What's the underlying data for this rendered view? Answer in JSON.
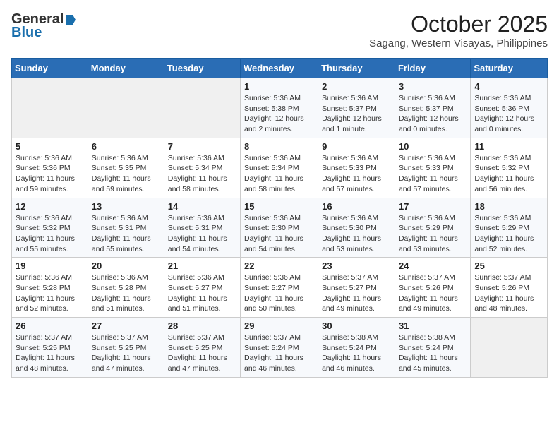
{
  "header": {
    "logo_general": "General",
    "logo_blue": "Blue",
    "month_year": "October 2025",
    "location": "Sagang, Western Visayas, Philippines"
  },
  "days_of_week": [
    "Sunday",
    "Monday",
    "Tuesday",
    "Wednesday",
    "Thursday",
    "Friday",
    "Saturday"
  ],
  "weeks": [
    [
      {
        "day": "",
        "info": ""
      },
      {
        "day": "",
        "info": ""
      },
      {
        "day": "",
        "info": ""
      },
      {
        "day": "1",
        "info": "Sunrise: 5:36 AM\nSunset: 5:38 PM\nDaylight: 12 hours\nand 2 minutes."
      },
      {
        "day": "2",
        "info": "Sunrise: 5:36 AM\nSunset: 5:37 PM\nDaylight: 12 hours\nand 1 minute."
      },
      {
        "day": "3",
        "info": "Sunrise: 5:36 AM\nSunset: 5:37 PM\nDaylight: 12 hours\nand 0 minutes."
      },
      {
        "day": "4",
        "info": "Sunrise: 5:36 AM\nSunset: 5:36 PM\nDaylight: 12 hours\nand 0 minutes."
      }
    ],
    [
      {
        "day": "5",
        "info": "Sunrise: 5:36 AM\nSunset: 5:36 PM\nDaylight: 11 hours\nand 59 minutes."
      },
      {
        "day": "6",
        "info": "Sunrise: 5:36 AM\nSunset: 5:35 PM\nDaylight: 11 hours\nand 59 minutes."
      },
      {
        "day": "7",
        "info": "Sunrise: 5:36 AM\nSunset: 5:34 PM\nDaylight: 11 hours\nand 58 minutes."
      },
      {
        "day": "8",
        "info": "Sunrise: 5:36 AM\nSunset: 5:34 PM\nDaylight: 11 hours\nand 58 minutes."
      },
      {
        "day": "9",
        "info": "Sunrise: 5:36 AM\nSunset: 5:33 PM\nDaylight: 11 hours\nand 57 minutes."
      },
      {
        "day": "10",
        "info": "Sunrise: 5:36 AM\nSunset: 5:33 PM\nDaylight: 11 hours\nand 57 minutes."
      },
      {
        "day": "11",
        "info": "Sunrise: 5:36 AM\nSunset: 5:32 PM\nDaylight: 11 hours\nand 56 minutes."
      }
    ],
    [
      {
        "day": "12",
        "info": "Sunrise: 5:36 AM\nSunset: 5:32 PM\nDaylight: 11 hours\nand 55 minutes."
      },
      {
        "day": "13",
        "info": "Sunrise: 5:36 AM\nSunset: 5:31 PM\nDaylight: 11 hours\nand 55 minutes."
      },
      {
        "day": "14",
        "info": "Sunrise: 5:36 AM\nSunset: 5:31 PM\nDaylight: 11 hours\nand 54 minutes."
      },
      {
        "day": "15",
        "info": "Sunrise: 5:36 AM\nSunset: 5:30 PM\nDaylight: 11 hours\nand 54 minutes."
      },
      {
        "day": "16",
        "info": "Sunrise: 5:36 AM\nSunset: 5:30 PM\nDaylight: 11 hours\nand 53 minutes."
      },
      {
        "day": "17",
        "info": "Sunrise: 5:36 AM\nSunset: 5:29 PM\nDaylight: 11 hours\nand 53 minutes."
      },
      {
        "day": "18",
        "info": "Sunrise: 5:36 AM\nSunset: 5:29 PM\nDaylight: 11 hours\nand 52 minutes."
      }
    ],
    [
      {
        "day": "19",
        "info": "Sunrise: 5:36 AM\nSunset: 5:28 PM\nDaylight: 11 hours\nand 52 minutes."
      },
      {
        "day": "20",
        "info": "Sunrise: 5:36 AM\nSunset: 5:28 PM\nDaylight: 11 hours\nand 51 minutes."
      },
      {
        "day": "21",
        "info": "Sunrise: 5:36 AM\nSunset: 5:27 PM\nDaylight: 11 hours\nand 51 minutes."
      },
      {
        "day": "22",
        "info": "Sunrise: 5:36 AM\nSunset: 5:27 PM\nDaylight: 11 hours\nand 50 minutes."
      },
      {
        "day": "23",
        "info": "Sunrise: 5:37 AM\nSunset: 5:27 PM\nDaylight: 11 hours\nand 49 minutes."
      },
      {
        "day": "24",
        "info": "Sunrise: 5:37 AM\nSunset: 5:26 PM\nDaylight: 11 hours\nand 49 minutes."
      },
      {
        "day": "25",
        "info": "Sunrise: 5:37 AM\nSunset: 5:26 PM\nDaylight: 11 hours\nand 48 minutes."
      }
    ],
    [
      {
        "day": "26",
        "info": "Sunrise: 5:37 AM\nSunset: 5:25 PM\nDaylight: 11 hours\nand 48 minutes."
      },
      {
        "day": "27",
        "info": "Sunrise: 5:37 AM\nSunset: 5:25 PM\nDaylight: 11 hours\nand 47 minutes."
      },
      {
        "day": "28",
        "info": "Sunrise: 5:37 AM\nSunset: 5:25 PM\nDaylight: 11 hours\nand 47 minutes."
      },
      {
        "day": "29",
        "info": "Sunrise: 5:37 AM\nSunset: 5:24 PM\nDaylight: 11 hours\nand 46 minutes."
      },
      {
        "day": "30",
        "info": "Sunrise: 5:38 AM\nSunset: 5:24 PM\nDaylight: 11 hours\nand 46 minutes."
      },
      {
        "day": "31",
        "info": "Sunrise: 5:38 AM\nSunset: 5:24 PM\nDaylight: 11 hours\nand 45 minutes."
      },
      {
        "day": "",
        "info": ""
      }
    ]
  ]
}
